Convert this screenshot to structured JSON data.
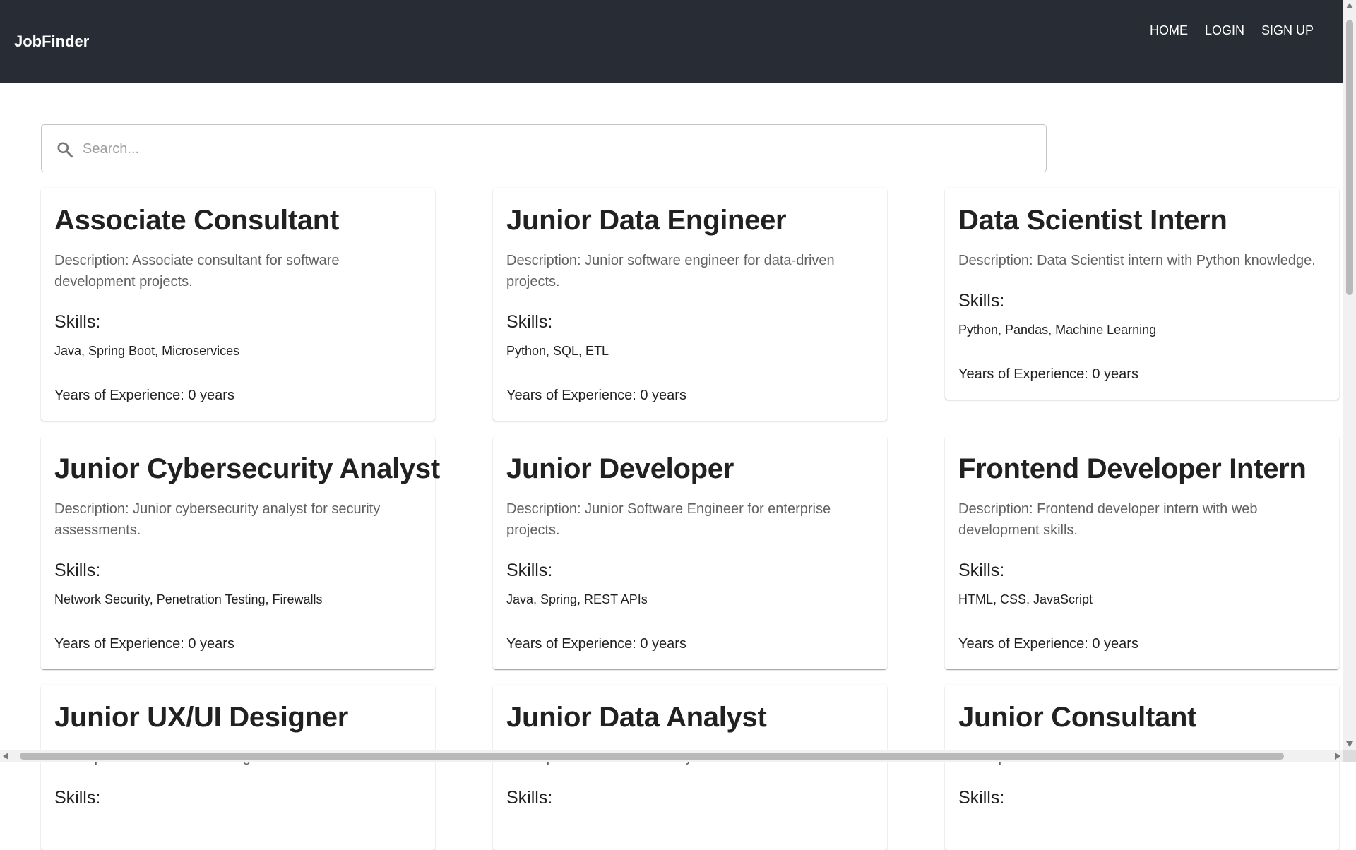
{
  "brand": "JobFinder",
  "nav": [
    "HOME",
    "LOGIN",
    "SIGN UP"
  ],
  "search": {
    "placeholder": "Search..."
  },
  "labels": {
    "skills": "Skills:"
  },
  "jobs": [
    {
      "title": "Associate Consultant",
      "description": "Description: Associate consultant for software development projects.",
      "skills": "Java, Spring Boot, Microservices",
      "experience": "Years of Experience: 0 years"
    },
    {
      "title": "Junior Data Engineer",
      "description": "Description: Junior software engineer for data-driven projects.",
      "skills": "Python, SQL, ETL",
      "experience": "Years of Experience: 0 years"
    },
    {
      "title": "Data Scientist Intern",
      "description": "Description: Data Scientist intern with Python knowledge.",
      "skills": "Python, Pandas, Machine Learning",
      "experience": "Years of Experience: 0 years"
    },
    {
      "title": "Junior Cybersecurity Analyst",
      "description": "Description: Junior cybersecurity analyst for security assessments.",
      "skills": "Network Security, Penetration Testing, Firewalls",
      "experience": "Years of Experience: 0 years"
    },
    {
      "title": "Junior Developer",
      "description": "Description: Junior Software Engineer for enterprise projects.",
      "skills": "Java, Spring, REST APIs",
      "experience": "Years of Experience: 0 years"
    },
    {
      "title": "Frontend Developer Intern",
      "description": "Description: Frontend developer intern with web development skills.",
      "skills": "HTML, CSS, JavaScript",
      "experience": "Years of Experience: 0 years"
    },
    {
      "title": "Junior UX/UI Designer",
      "description": "Description: Junior UX/UI designer for web and mobile",
      "skills": "",
      "experience": ""
    },
    {
      "title": "Junior Data Analyst",
      "description": "Description: Junior data analyst for data visualization",
      "skills": "",
      "experience": ""
    },
    {
      "title": "Junior Consultant",
      "description": "Description: Junior consultant for software architecture",
      "skills": "",
      "experience": ""
    }
  ]
}
